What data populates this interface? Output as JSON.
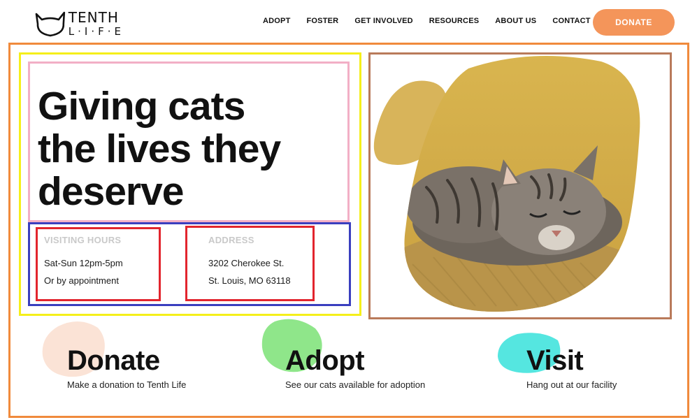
{
  "brand": {
    "logo_line1": "TENTH",
    "logo_line2": "L·I·F·E",
    "icon": "cat-head-icon"
  },
  "nav": {
    "items": [
      "ADOPT",
      "FOSTER",
      "GET INVOLVED",
      "RESOURCES",
      "ABOUT US",
      "CONTACT"
    ],
    "donate_label": "DONATE"
  },
  "hero": {
    "headline_lines": [
      "Giving cats",
      "the lives they",
      "deserve"
    ],
    "hours": {
      "label": "VISITING HOURS",
      "line1": "Sat-Sun 12pm-5pm",
      "line2": "Or by appointment"
    },
    "address": {
      "label": "ADDRESS",
      "line1": "3202 Cherokee St.",
      "line2": "St. Louis, MO 63118"
    },
    "image_icon": "sleeping-tabby-cat-photo"
  },
  "ctas": [
    {
      "title": "Donate",
      "subtitle": "Make a donation to Tenth Life",
      "blob_color": "#fbe3d6"
    },
    {
      "title": "Adopt",
      "subtitle": "See our cats available for adoption",
      "blob_color": "#8fe68a"
    },
    {
      "title": "Visit",
      "subtitle": "Hang out at our facility",
      "blob_color": "#55e6e0"
    }
  ],
  "colors": {
    "accent_orange": "#f4955a",
    "annotation_orange": "#f08a3c",
    "annotation_yellow": "#f5ef1a",
    "annotation_pink": "#f2afc6",
    "annotation_blue": "#3a3fbf",
    "annotation_red": "#e2252e",
    "annotation_brown": "#b97a5a",
    "mustard": "#d9b54f"
  }
}
